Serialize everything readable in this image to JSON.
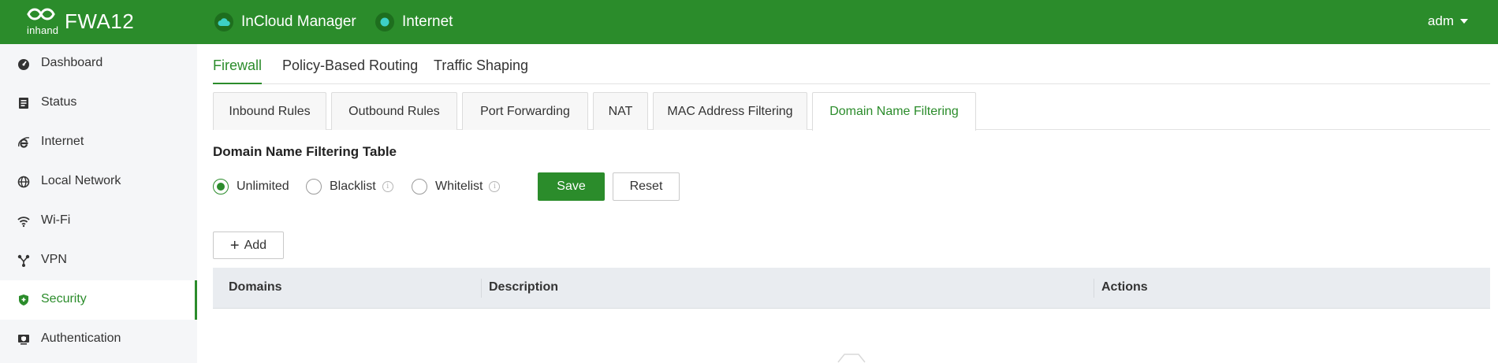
{
  "header": {
    "brand_small": "inhand",
    "brand_name": "FWA12",
    "cloud_label": "InCloud Manager",
    "internet_label": "Internet",
    "user_name": "adm",
    "color": "#2b8c2b"
  },
  "sidebar": {
    "items": [
      {
        "label": "Dashboard",
        "icon": "dashboard-icon"
      },
      {
        "label": "Status",
        "icon": "status-icon"
      },
      {
        "label": "Internet",
        "icon": "internet-icon"
      },
      {
        "label": "Local Network",
        "icon": "globe-icon"
      },
      {
        "label": "Wi-Fi",
        "icon": "wifi-icon"
      },
      {
        "label": "VPN",
        "icon": "vpn-icon"
      },
      {
        "label": "Security",
        "icon": "shield-icon",
        "active": true
      },
      {
        "label": "Authentication",
        "icon": "authentication-icon"
      }
    ]
  },
  "main": {
    "tabs": [
      {
        "label": "Firewall",
        "active": true
      },
      {
        "label": "Policy-Based Routing"
      },
      {
        "label": "Traffic Shaping"
      }
    ],
    "subtabs": [
      {
        "label": "Inbound Rules"
      },
      {
        "label": "Outbound Rules"
      },
      {
        "label": "Port Forwarding"
      },
      {
        "label": "NAT"
      },
      {
        "label": "MAC Address Filtering"
      },
      {
        "label": "Domain Name Filtering",
        "active": true
      }
    ],
    "section_title": "Domain Name Filtering Table",
    "mode_options": [
      {
        "label": "Unlimited",
        "checked": true
      },
      {
        "label": "Blacklist",
        "info": "i"
      },
      {
        "label": "Whitelist",
        "info": "i"
      }
    ],
    "save_label": "Save",
    "reset_label": "Reset",
    "add_label": "Add",
    "table": {
      "columns": [
        "Domains",
        "Description",
        "Actions"
      ],
      "rows": []
    }
  }
}
